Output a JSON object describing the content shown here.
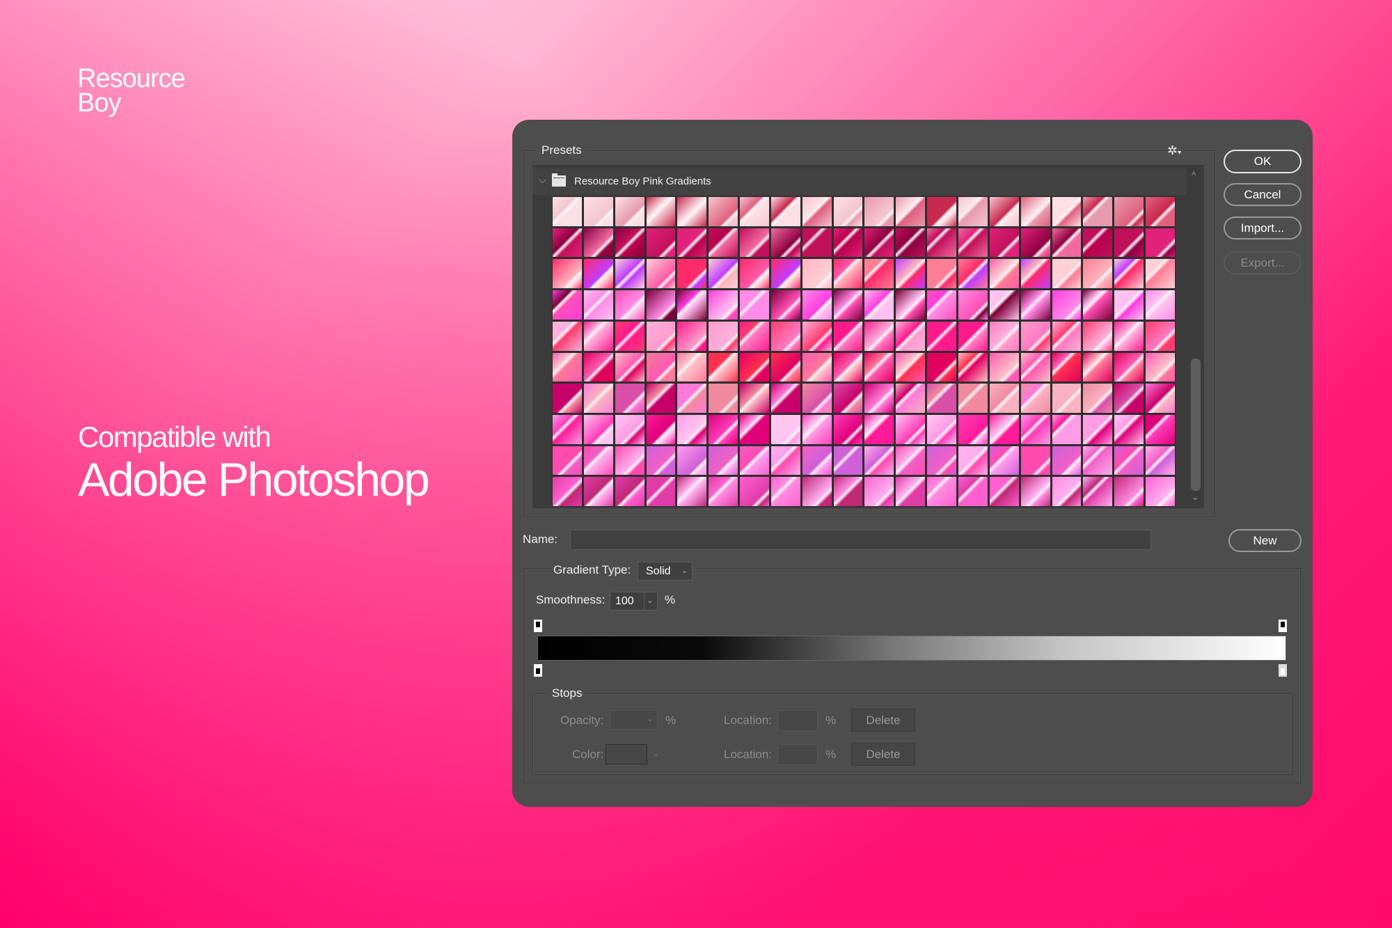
{
  "brand": {
    "line1": "Resource",
    "line2": "Boy"
  },
  "headline": {
    "small": "Compatible with",
    "large": "Adobe Photoshop"
  },
  "dialog": {
    "presets_label": "Presets",
    "gear_icon": "gear-icon",
    "folder": {
      "name": "Resource Boy Pink Gradients",
      "expanded": true,
      "icon": "folder-icon"
    },
    "swatch_grid": {
      "columns": 20,
      "rows": 10,
      "row_palettes": [
        [
          "#f4c6cf",
          "#e89aae",
          "#fbe1e6",
          "#c8294f",
          "#e0607e"
        ],
        [
          "#c0105a",
          "#8c0040",
          "#e2217a",
          "#f06aa0",
          "#b8004d"
        ],
        [
          "#ffb3bd",
          "#ff7d95",
          "#ffd0d6",
          "#ff2a6a",
          "#ff5aa8",
          "#c03cff"
        ],
        [
          "#ff3de0",
          "#ff8ce8",
          "#ffc2f0",
          "#ff4fb5",
          "#7a0038"
        ],
        [
          "#ff1a8c",
          "#ff7ac2",
          "#ffb0dc",
          "#ff3d6e",
          "#ff9ccd"
        ],
        [
          "#ff5ab0",
          "#e0005e",
          "#ff7a9a",
          "#ffc0c8",
          "#ff3050"
        ],
        [
          "#f9b2c0",
          "#f08a9f",
          "#d94fa8",
          "#ff7ad8",
          "#c8006a"
        ],
        [
          "#ff3cb8",
          "#ff9ce6",
          "#ff1a9a",
          "#ffc6f2",
          "#e0007a"
        ],
        [
          "#f060c8",
          "#ff9cf0",
          "#ff4ab0",
          "#d060d8",
          "#ffb0ee"
        ],
        [
          "#ffb0f0",
          "#e03ca8",
          "#ff60d0",
          "#c02878",
          "#ff8ce0"
        ]
      ]
    },
    "buttons": {
      "ok": "OK",
      "cancel": "Cancel",
      "import": "Import...",
      "export": "Export...",
      "new": "New"
    },
    "name": {
      "label": "Name:",
      "value": ""
    },
    "gradient_type": {
      "label": "Gradient Type:",
      "value": "Solid"
    },
    "smoothness": {
      "label": "Smoothness:",
      "value": "100",
      "unit": "%"
    },
    "gradient_bar": {
      "start_color": "#000000",
      "end_color": "#ffffff"
    },
    "stops": {
      "label": "Stops",
      "opacity": {
        "label": "Opacity:",
        "value": "",
        "unit": "%",
        "location_label": "Location:",
        "location_value": "",
        "location_unit": "%",
        "delete": "Delete"
      },
      "color": {
        "label": "Color:",
        "location_label": "Location:",
        "location_value": "",
        "location_unit": "%",
        "delete": "Delete"
      }
    }
  }
}
